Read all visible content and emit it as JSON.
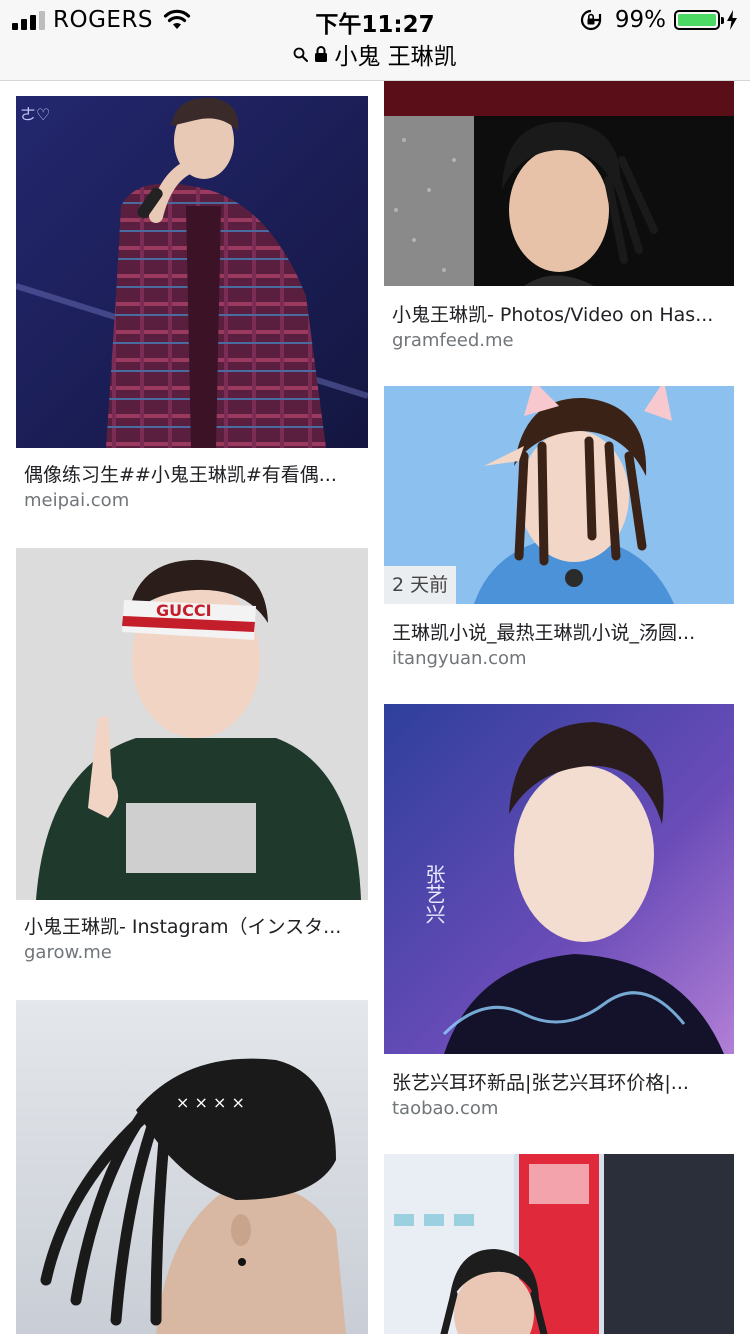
{
  "status_bar": {
    "carrier": "ROGERS",
    "time": "下午11:27",
    "battery_percent": "99%",
    "battery_level": 0.99,
    "battery_color": "#4cd964"
  },
  "url_bar": {
    "search_icon": "search-icon",
    "lock_icon": "lock-icon",
    "query": "小鬼 王琳凯"
  },
  "results": [
    {
      "title": "偶像练习生##小鬼王琳凯#有看偶...",
      "source": "meipai.com",
      "image": "performer in plaid suit with microphone"
    },
    {
      "title": "小鬼王琳凯- Photos/Video on Has...",
      "source": "gramfeed.me",
      "image": "young man with dreadlocks"
    },
    {
      "title": "王琳凯小说_最热王琳凯小说_汤圆...",
      "source": "itangyuan.com",
      "image": "dreadlocks with cat ears filter",
      "badge": "2 天前"
    },
    {
      "title": "小鬼王琳凯- Instagram（インスタ...",
      "source": "garow.me",
      "image": "person with red headband making hand sign",
      "headband_text": "GUCCI"
    },
    {
      "title": "张艺兴耳环新品|张艺兴耳环价格|...",
      "source": "taobao.com",
      "image": "portrait with purple background",
      "overlay_text": "张艺兴"
    },
    {
      "title": "",
      "source": "",
      "image": "back of head with dreadlock ponytail"
    },
    {
      "title": "",
      "source": "",
      "image": "person with dreadlocks near vending machine"
    }
  ]
}
